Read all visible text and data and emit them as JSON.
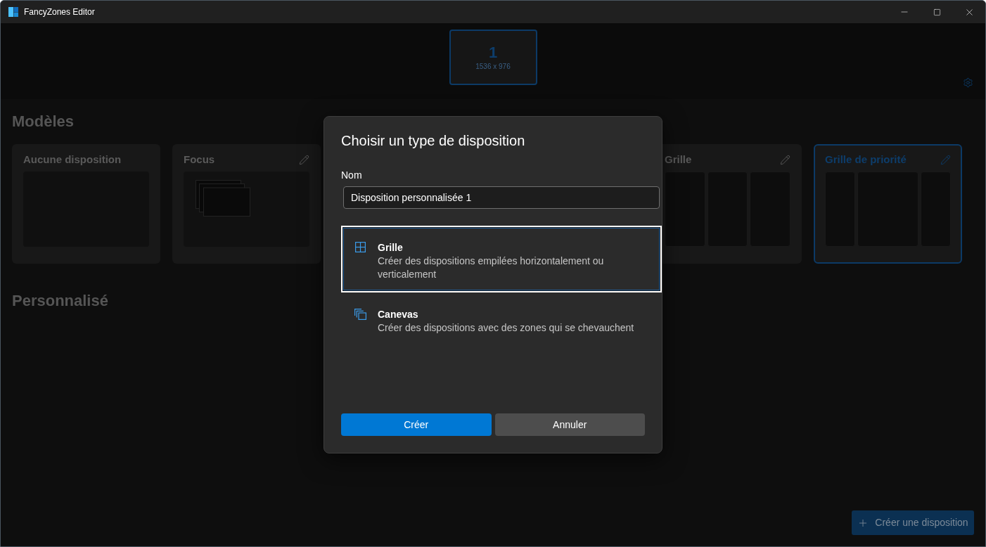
{
  "window": {
    "title": "FancyZones Editor"
  },
  "monitors": [
    {
      "number": "1",
      "resolution": "1536 x 976",
      "selected": true
    }
  ],
  "templates": {
    "heading": "Modèles",
    "items": [
      {
        "name": "Aucune disposition",
        "kind": "blank",
        "editable": false,
        "selected": false
      },
      {
        "name": "Focus",
        "kind": "focus",
        "editable": true,
        "selected": false
      },
      {
        "name": "Grille",
        "kind": "columns",
        "editable": true,
        "selected": false
      },
      {
        "name": "Grille de priorité",
        "kind": "priority",
        "editable": true,
        "selected": true
      }
    ]
  },
  "custom": {
    "heading": "Personnalisé"
  },
  "create_button": {
    "label": "Créer une disposition"
  },
  "dialog": {
    "title": "Choisir un type de disposition",
    "name_label": "Nom",
    "name_value": "Disposition personnalisée 1",
    "options": [
      {
        "kind": "grid",
        "title": "Grille",
        "description": "Créer des dispositions empilées horizontalement ou verticalement",
        "selected": true
      },
      {
        "kind": "canvas",
        "title": "Canevas",
        "description": "Créer des dispositions avec des zones qui se chevauchent",
        "selected": false
      }
    ],
    "buttons": [
      {
        "label": "Créer",
        "kind": "primary"
      },
      {
        "label": "Annuler",
        "kind": "secondary"
      }
    ]
  }
}
